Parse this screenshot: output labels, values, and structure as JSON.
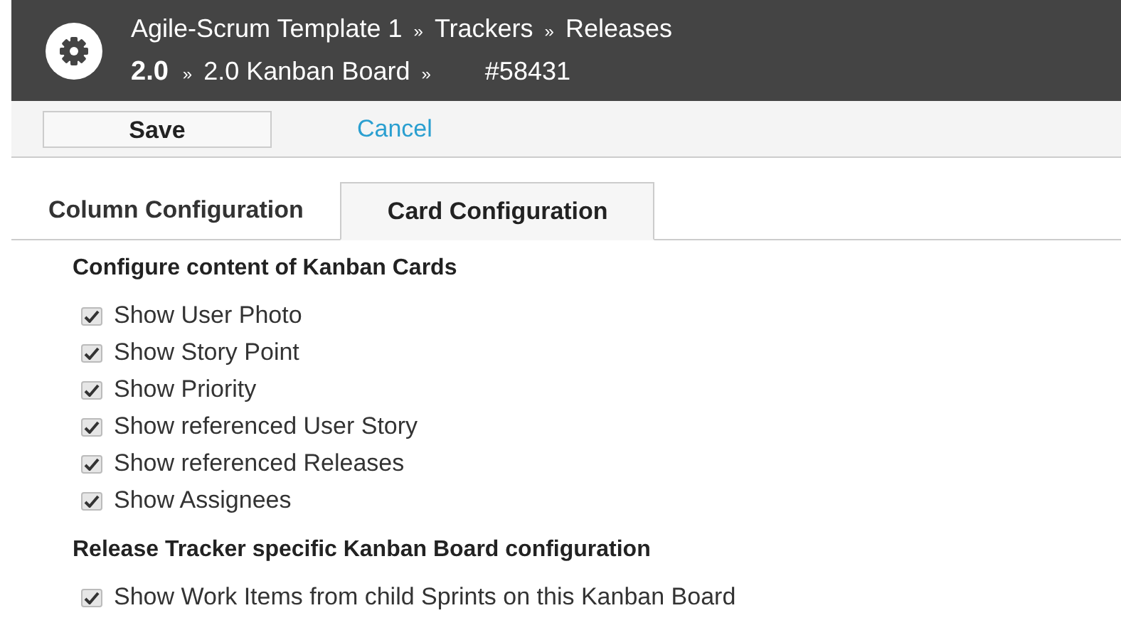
{
  "header": {
    "breadcrumb_lines": [
      [
        {
          "text": "Agile-Scrum Template 1",
          "bold": false
        },
        {
          "text": "»",
          "kind": "separator"
        },
        {
          "text": "Trackers",
          "bold": false
        },
        {
          "text": "»",
          "kind": "separator"
        },
        {
          "text": "Releases",
          "bold": false
        }
      ],
      [
        {
          "text": "2.0",
          "bold": true
        },
        {
          "text": "»",
          "kind": "separator"
        },
        {
          "text": "2.0 Kanban Board",
          "bold": false
        },
        {
          "text": "»",
          "kind": "separator"
        },
        {
          "text": "#58431",
          "bold": false
        }
      ]
    ]
  },
  "toolbar": {
    "save": "Save",
    "cancel": "Cancel"
  },
  "tabs": [
    {
      "label": "Column Configuration",
      "selected": false
    },
    {
      "label": "Card Configuration",
      "selected": true
    }
  ],
  "sections": [
    {
      "heading": "Configure content of Kanban Cards",
      "options": [
        {
          "label": "Show User Photo",
          "checked": true
        },
        {
          "label": "Show Story Point",
          "checked": true
        },
        {
          "label": "Show Priority",
          "checked": true
        },
        {
          "label": "Show referenced User Story",
          "checked": true
        },
        {
          "label": "Show referenced Releases",
          "checked": true
        },
        {
          "label": "Show Assignees",
          "checked": true
        }
      ]
    },
    {
      "heading": "Release Tracker specific Kanban Board configuration",
      "options": [
        {
          "label": "Show Work Items from child Sprints on this Kanban Board",
          "checked": true
        }
      ]
    }
  ]
}
